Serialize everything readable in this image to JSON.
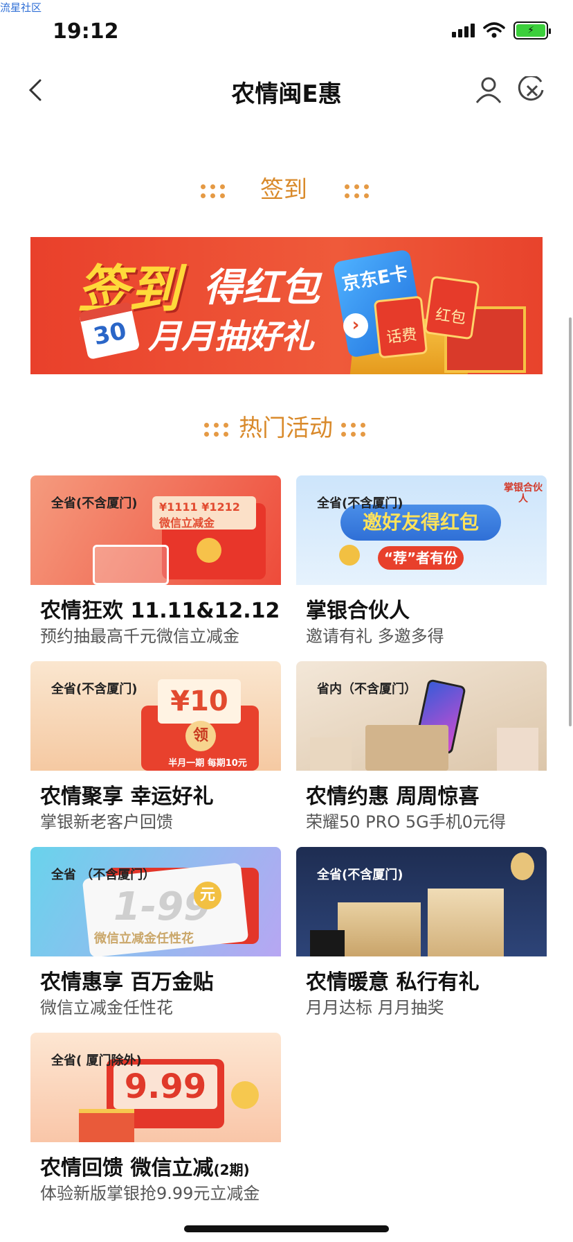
{
  "watermark": "流星社区",
  "status": {
    "time": "19:12"
  },
  "nav": {
    "title": "农情闽E惠",
    "back_icon": "chevron-left-icon",
    "user_icon": "user-icon",
    "close_icon": "close-circle-icon"
  },
  "sections": {
    "signin_title": "签到",
    "hot_title": "热门活动"
  },
  "banner": {
    "headline_a": "签到",
    "headline_b": "得红包",
    "subline": "月月抽好礼",
    "calendar_day": "30",
    "card_text": "京东E卡",
    "envelope_1": "话费",
    "envelope_2": "红包",
    "colors": {
      "bg": "#e9402b",
      "accent": "#ffd93a"
    }
  },
  "activities": [
    {
      "tag": "全省(不含厦门)",
      "title": "农情狂欢 11.11&12.12",
      "subtitle": "预约抽最高千元微信立减金",
      "art_text": "¥1111 ¥1212 微信立减金",
      "bg": "#f26a55"
    },
    {
      "tag": "全省(不含厦门)",
      "title": "掌银合伙人",
      "subtitle": "邀请有礼  多邀多得",
      "art_text": "邀好友得红包",
      "art_sub": "“荐”者有份",
      "corner": "掌银合伙人",
      "bg": "#cfe6fb"
    },
    {
      "tag": "全省(不含厦门)",
      "title": "农情聚享 幸运好礼",
      "subtitle": "掌银新老客户回馈",
      "art_text": "¥10",
      "art_sub": "半月一期 每期10元",
      "art_btn": "领",
      "bg": "#f8d9b8"
    },
    {
      "tag": "省内（不含厦门）",
      "title": "农情约惠 周周惊喜",
      "subtitle": "荣耀50 PRO 5G手机0元得",
      "bg": "#efe0cc"
    },
    {
      "tag": "全省 （不含厦门）",
      "title": "农情惠享 百万金贴",
      "subtitle": "微信立减金任性花",
      "art_text": "1-99",
      "art_unit": "元",
      "art_sub": "微信立减金任性花",
      "bg": "#7fd9e3"
    },
    {
      "tag": "全省(不含厦门)",
      "title": "农情暖意 私行有礼",
      "subtitle": "月月达标  月月抽奖",
      "bg": "#24365e"
    },
    {
      "tag": "全省( 厦门除外)",
      "title": "农情回馈 微信立减",
      "title_suffix": "(2期)",
      "subtitle": "体验新版掌银抢9.99元立减金",
      "art_text": "9.99",
      "bg": "#fbd2b9"
    }
  ]
}
